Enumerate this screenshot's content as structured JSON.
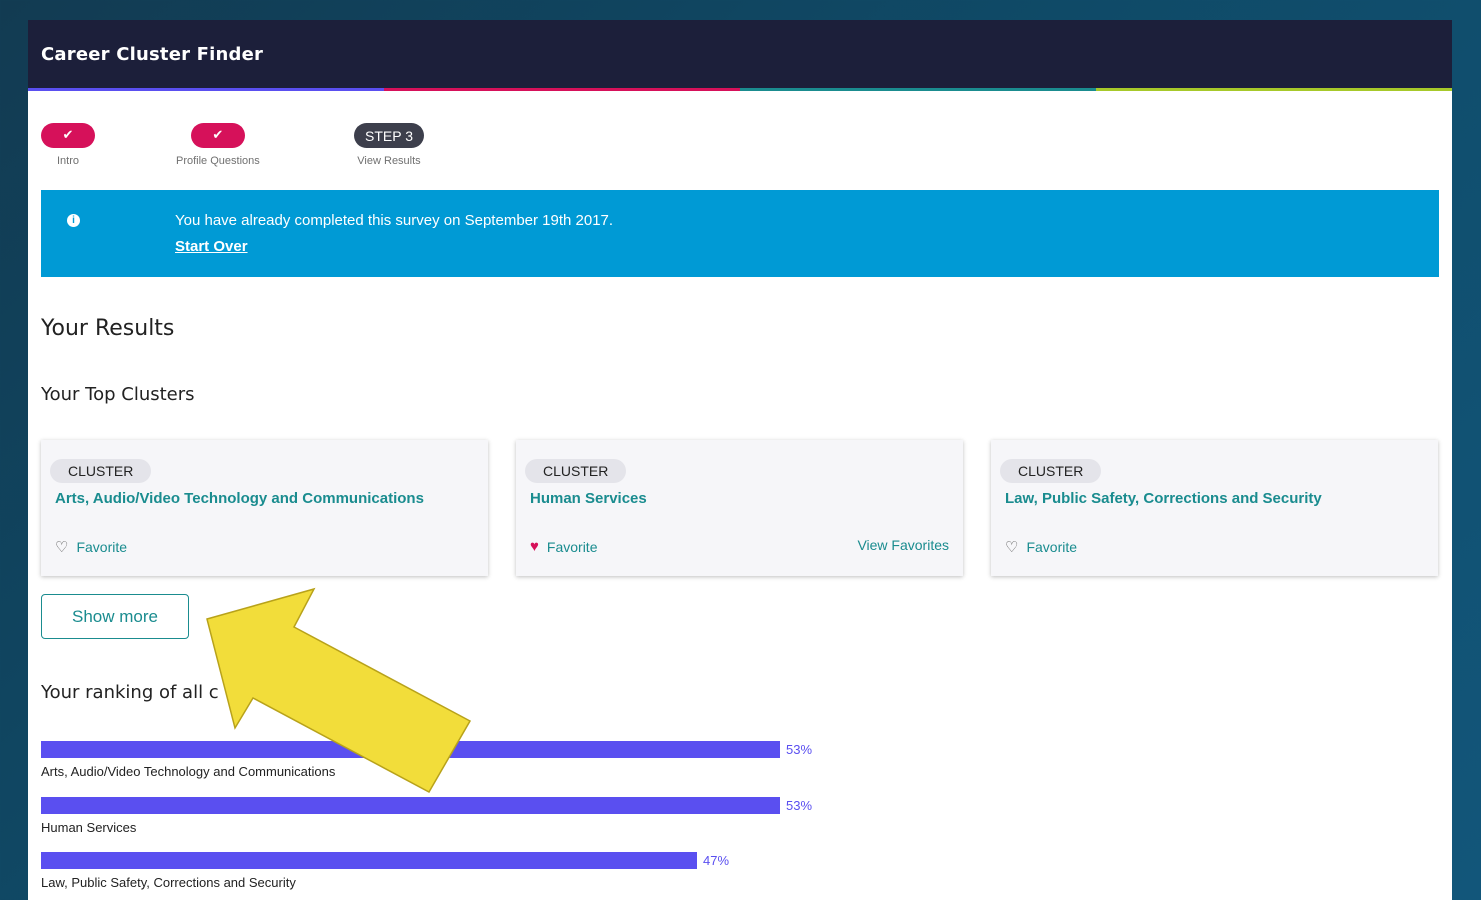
{
  "app": {
    "title": "Career Cluster Finder"
  },
  "colors": {
    "header_bg": "#1c1f3a",
    "accent_pink": "#d6115a",
    "alert_bg": "#009ad5",
    "teal": "#1a8c8f",
    "bar": "#5a4ff0",
    "arrow": "#f2dd3a"
  },
  "progress_stripe": [
    "#5a4ff0",
    "#d6115a",
    "#1a8c8f",
    "#a7c92a"
  ],
  "steps": [
    {
      "label": "Intro",
      "state": "done",
      "icon": "check-icon"
    },
    {
      "label": "Profile Questions",
      "state": "done",
      "icon": "check-icon"
    },
    {
      "label": "View Results",
      "state": "current",
      "badge": "STEP 3"
    }
  ],
  "alert": {
    "icon": "info-icon",
    "message": "You have already completed this survey on September 19th 2017.",
    "link": "Start Over"
  },
  "results": {
    "heading": "Your Results",
    "top_heading": "Your Top Clusters",
    "cards": [
      {
        "tag": "CLUSTER",
        "title": "Arts, Audio/Video Technology and Communications",
        "favorite_label": "Favorite",
        "favorited": false
      },
      {
        "tag": "CLUSTER",
        "title": "Human Services",
        "favorite_label": "Favorite",
        "favorited": true,
        "view_favorites": "View Favorites"
      },
      {
        "tag": "CLUSTER",
        "title": "Law, Public Safety, Corrections and Security",
        "favorite_label": "Favorite",
        "favorited": false
      }
    ],
    "show_more": "Show more",
    "ranking_heading": "Your ranking of all c",
    "ranking": [
      {
        "label": "Arts, Audio/Video Technology and Communications",
        "percent": 53,
        "percent_text": "53%"
      },
      {
        "label": "Human Services",
        "percent": 53,
        "percent_text": "53%"
      },
      {
        "label": "Law, Public Safety, Corrections and Security",
        "percent": 47,
        "percent_text": "47%"
      }
    ]
  }
}
